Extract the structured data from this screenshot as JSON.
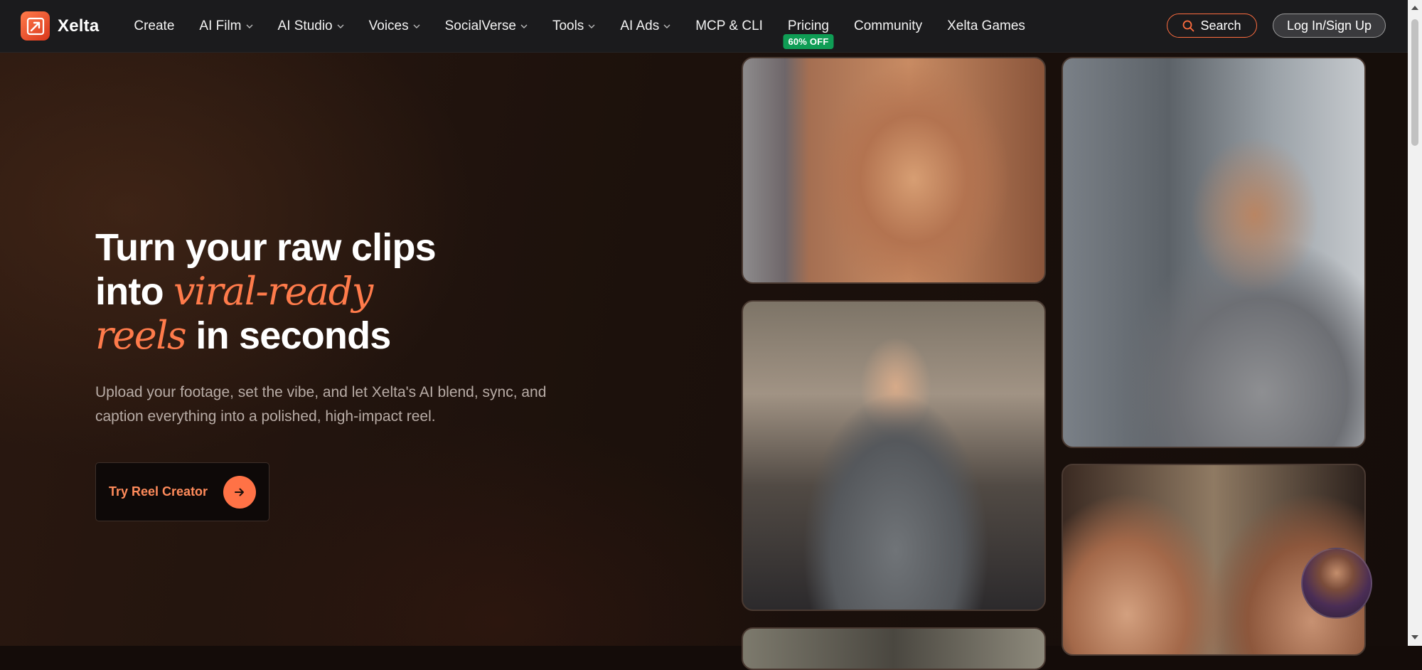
{
  "brand": {
    "name": "Xelta",
    "accent": "#ff6d3f"
  },
  "nav": {
    "items": [
      {
        "label": "Create",
        "dropdown": false
      },
      {
        "label": "AI Film",
        "dropdown": true
      },
      {
        "label": "AI Studio",
        "dropdown": true
      },
      {
        "label": "Voices",
        "dropdown": true
      },
      {
        "label": "SocialVerse",
        "dropdown": true
      },
      {
        "label": "Tools",
        "dropdown": true
      },
      {
        "label": "AI Ads",
        "dropdown": true
      },
      {
        "label": "MCP & CLI",
        "dropdown": false
      },
      {
        "label": "Pricing",
        "dropdown": false,
        "badge": "60% OFF"
      },
      {
        "label": "Community",
        "dropdown": false
      },
      {
        "label": "Xelta Games",
        "dropdown": false
      }
    ],
    "search_label": "Search",
    "login_label": "Log In/Sign Up"
  },
  "hero": {
    "line1": "Turn your raw clips",
    "line2_start": "into ",
    "line2_italic": "viral-ready",
    "line3_italic": "reels",
    "line3_end": " in seconds",
    "subtitle": "Upload your footage, set the vibe, and let Xelta's AI blend, sync, and caption everything into a polished, high-impact reel.",
    "cta_label": "Try Reel Creator"
  },
  "colors": {
    "badge_green": "#0f9d55",
    "cta_orange": "#ff7246",
    "italic_orange": "#ff7b4b"
  }
}
